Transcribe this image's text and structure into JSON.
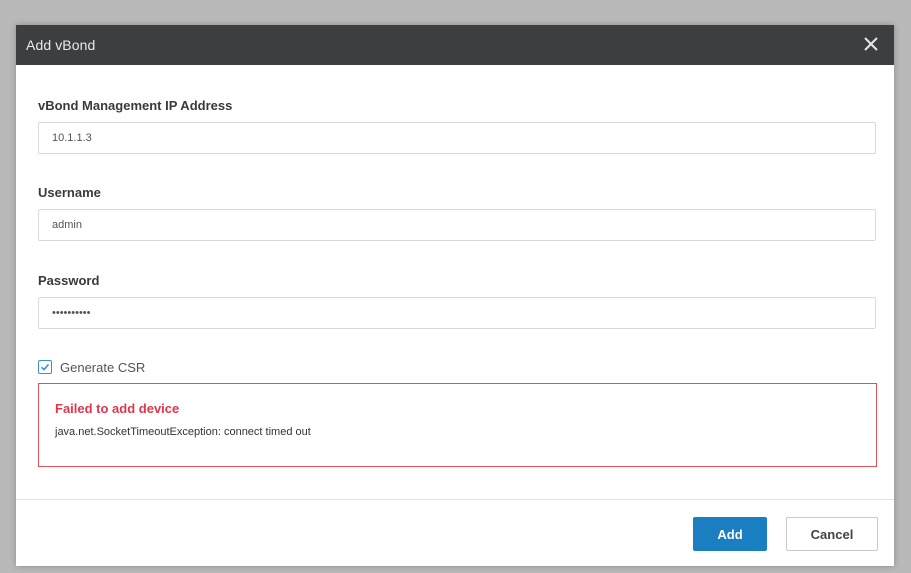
{
  "dialog": {
    "title": "Add vBond",
    "close_icon": "close-icon"
  },
  "form": {
    "vbond_ip": {
      "label": "vBond Management IP Address",
      "value": "10.1.1.3"
    },
    "username": {
      "label": "Username",
      "value": "admin"
    },
    "password": {
      "label": "Password",
      "value": "••••••••••"
    },
    "generate_csr": {
      "label": "Generate CSR",
      "checked": true,
      "icon": "checkmark-icon"
    }
  },
  "error": {
    "title": "Failed to add device",
    "message": "java.net.SocketTimeoutException: connect timed out"
  },
  "footer": {
    "add_label": "Add",
    "cancel_label": "Cancel"
  },
  "colors": {
    "header_bg": "#3c3f42",
    "primary": "#1a7fc1",
    "error": "#e0364a",
    "checkbox": "#3b8fcf"
  }
}
